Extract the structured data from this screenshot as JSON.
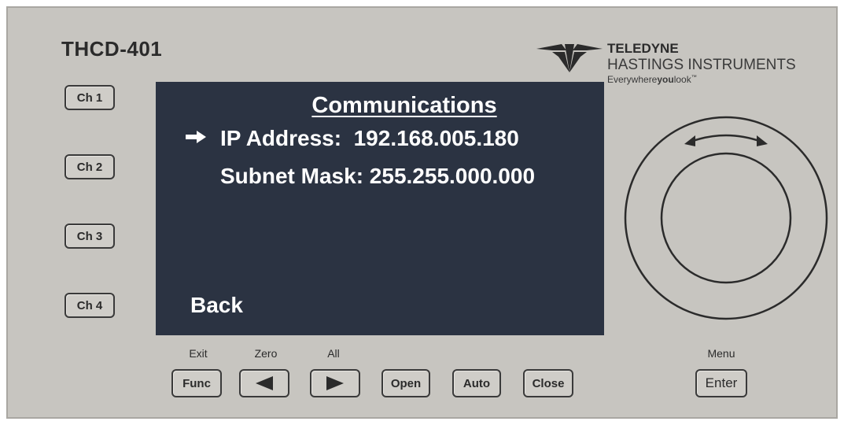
{
  "device": {
    "model": "THCD-401",
    "logo": {
      "line1": "TELEDYNE",
      "line2": "HASTINGS INSTRUMENTS",
      "tagline_a": "Everywhere",
      "tagline_b": "you",
      "tagline_c": "look",
      "tagline_tm": "™"
    }
  },
  "channels": [
    {
      "label": "Ch 1"
    },
    {
      "label": "Ch 2"
    },
    {
      "label": "Ch 3"
    },
    {
      "label": "Ch 4"
    }
  ],
  "screen": {
    "title": "Communications",
    "rows": [
      {
        "text": "IP Address:  192.168.005.180",
        "selected": true
      },
      {
        "text": "Subnet Mask: 255.255.000.000",
        "selected": false
      }
    ],
    "back": "Back",
    "background": "#2b3342"
  },
  "buttons": {
    "func": {
      "label": "Func",
      "above": "Exit"
    },
    "left": {
      "above": "Zero"
    },
    "right": {
      "above": "All"
    },
    "open": {
      "label": "Open"
    },
    "auto": {
      "label": "Auto"
    },
    "close": {
      "label": "Close"
    },
    "enter": {
      "label": "Enter",
      "above": "Menu"
    }
  },
  "icons": {
    "arrow": "right-arrow-icon",
    "left": "left-triangle-icon",
    "right": "right-triangle-icon",
    "knob": "rotary-knob-icon",
    "logo": "teledyne-logo-icon"
  }
}
